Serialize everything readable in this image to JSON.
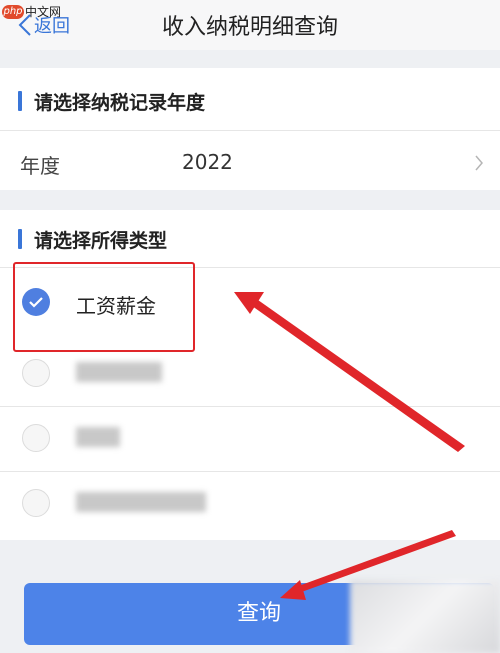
{
  "watermark": {
    "badge": "php",
    "text": "中文网"
  },
  "header": {
    "back_label": "返回",
    "title": "收入纳税明细查询"
  },
  "year_section": {
    "heading": "请选择纳税记录年度",
    "row_label": "年度",
    "row_value": "2022"
  },
  "income_section": {
    "heading": "请选择所得类型",
    "options": [
      {
        "label": "工资薪金",
        "selected": true
      }
    ]
  },
  "query_button": {
    "label": "查询"
  },
  "colors": {
    "accent": "#3a76d8",
    "button": "#4d83e8",
    "annotation": "#e0262a"
  }
}
